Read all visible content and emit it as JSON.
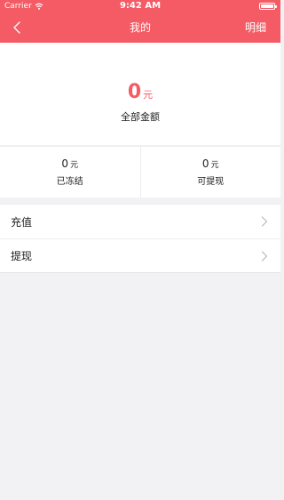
{
  "status_bar": {
    "carrier": "Carrier",
    "time": "9:42 AM"
  },
  "nav": {
    "title": "我的",
    "right_label": "明细"
  },
  "total": {
    "amount": "0",
    "unit": "元",
    "label": "全部金额"
  },
  "split": [
    {
      "amount": "0",
      "unit": "元",
      "label": "已冻结"
    },
    {
      "amount": "0",
      "unit": "元",
      "label": "可提现"
    }
  ],
  "menu": [
    {
      "label": "充值"
    },
    {
      "label": "提现"
    }
  ],
  "colors": {
    "accent": "#f45b64",
    "background": "#f2f2f4"
  }
}
